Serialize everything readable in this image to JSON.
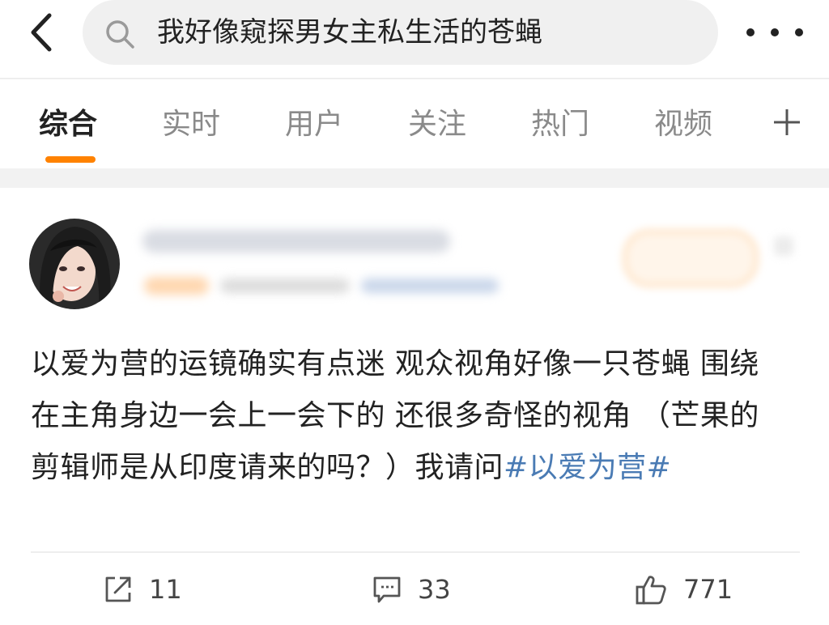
{
  "search": {
    "query": "我好像窥探男女主私生活的苍蝇",
    "back_icon": "chevron-left-icon",
    "search_icon": "search-icon",
    "more_icon": "more-dots-icon"
  },
  "tabs": [
    {
      "label": "综合",
      "active": true
    },
    {
      "label": "实时",
      "active": false
    },
    {
      "label": "用户",
      "active": false
    },
    {
      "label": "关注",
      "active": false
    },
    {
      "label": "热门",
      "active": false
    },
    {
      "label": "视频",
      "active": false
    }
  ],
  "tab_add_icon": "plus-icon",
  "colors": {
    "accent": "#ff8200",
    "hashtag": "#4a7bb4",
    "text_primary": "#222222",
    "text_secondary": "#8a8a8a"
  },
  "post": {
    "text": "以爱为营的运镜确实有点迷 观众视角好像一只苍蝇 围绕在主角身边一会上一会下的 还很多奇怪的视角  （芒果的剪辑师是从印度请来的吗？）我请问",
    "hashtag": "#以爱为营#",
    "actions": {
      "repost": {
        "icon": "share-icon",
        "count": "11"
      },
      "comment": {
        "icon": "comment-icon",
        "count": "33"
      },
      "like": {
        "icon": "thumbs-up-icon",
        "count": "771"
      }
    }
  }
}
